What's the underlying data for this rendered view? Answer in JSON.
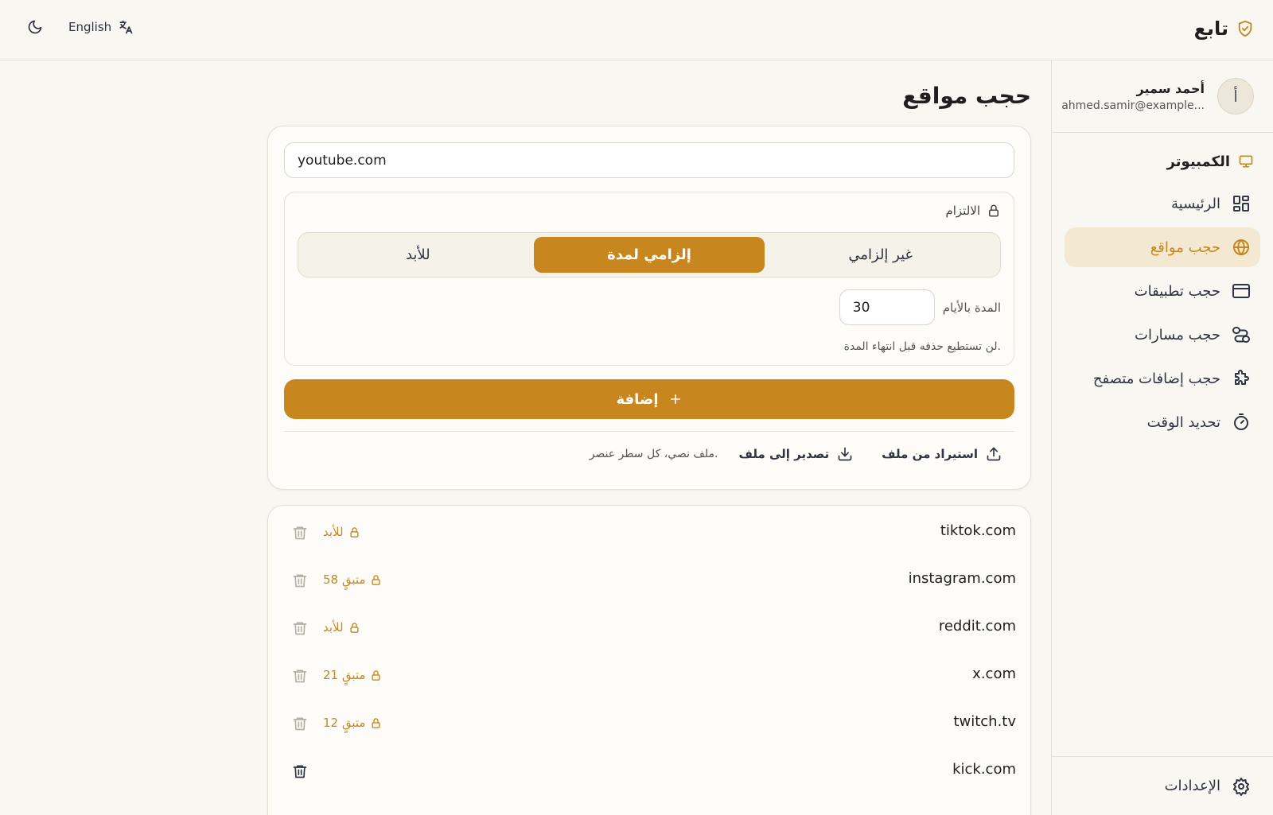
{
  "header": {
    "brand_name": "تابع",
    "language_label": "English"
  },
  "user": {
    "avatar_initial": "أ",
    "name": "أحمد سمير",
    "email": "ahmed.samir@example..."
  },
  "sidebar": {
    "device_label": "الكمبيوتر",
    "items": [
      {
        "label": "الرئيسية",
        "icon": "dashboard-icon"
      },
      {
        "label": "حجب مواقع",
        "icon": "globe-icon",
        "active": true
      },
      {
        "label": "حجب تطبيقات",
        "icon": "app-window-icon"
      },
      {
        "label": "حجب مسارات",
        "icon": "route-icon"
      },
      {
        "label": "حجب إضافات متصفح",
        "icon": "puzzle-icon"
      },
      {
        "label": "تحديد الوقت",
        "icon": "timer-icon"
      }
    ],
    "settings_label": "الإعدادات"
  },
  "main": {
    "title": "حجب مواقع",
    "url_input_value": "youtube.com",
    "commitment": {
      "label": "الالتزام",
      "options": [
        "غير إلزامي",
        "إلزامي لمدة",
        "للأبد"
      ],
      "selected": "إلزامي لمدة",
      "days_label": "المدة بالأيام",
      "days_value": "30",
      "hint": "لن تستطيع حذفه قبل انتهاء المدة."
    },
    "add_label": "إضافة",
    "import_label": "استيراد من ملف",
    "export_label": "تصدير إلى ملف",
    "io_hint": "ملف نصي، كل سطر عنصر."
  },
  "blocked_sites": [
    {
      "domain": "tiktok.com",
      "status": "للأبد",
      "locked": true
    },
    {
      "domain": "instagram.com",
      "status": "متبقٍ 58",
      "locked": true
    },
    {
      "domain": "reddit.com",
      "status": "للأبد",
      "locked": true
    },
    {
      "domain": "x.com",
      "status": "متبقٍ 21",
      "locked": true
    },
    {
      "domain": "twitch.tv",
      "status": "متبقٍ 12",
      "locked": true
    },
    {
      "domain": "kick.com",
      "status": "",
      "locked": false
    }
  ],
  "colors": {
    "accent": "#c8871e",
    "accent_soft": "#f3e8d2",
    "background": "#f8f7f2",
    "card": "#fdfcf9",
    "border": "#e3e0d6"
  }
}
